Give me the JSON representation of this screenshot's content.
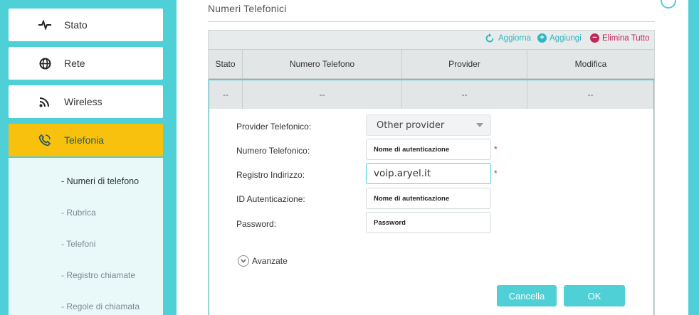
{
  "sidebar": {
    "items": [
      {
        "label": "Stato",
        "icon": "pulse-icon"
      },
      {
        "label": "Rete",
        "icon": "globe-icon"
      },
      {
        "label": "Wireless",
        "icon": "wifi-icon"
      },
      {
        "label": "Telefonia",
        "icon": "phone-icon"
      }
    ],
    "submenu": [
      "- Numeri di telefono",
      "- Rubrica",
      "- Telefoni",
      "- Registro chiamate",
      "- Regole di chiamata"
    ]
  },
  "main": {
    "title": "Numeri Telefonici",
    "toolbar": {
      "refresh": "Aggiorna",
      "add": "Aggiungi",
      "delete_all": "Elimina Tutto"
    },
    "table": {
      "headers": [
        "Stato",
        "Numero Telefono",
        "Provider",
        "Modifica"
      ],
      "row": [
        "--",
        "--",
        "--",
        "--"
      ]
    },
    "form": {
      "provider_label": "Provider Telefonico:",
      "provider_value": "Other provider",
      "number_label": "Numero Telefonico:",
      "number_value": "Nome di autenticazione",
      "registrar_label": "Registro Indirizzo:",
      "registrar_value": "voip.aryel.it",
      "auth_label": "ID Autenticazione:",
      "auth_value": "Nome di autenticazione",
      "password_label": "Password:",
      "password_value": "Password",
      "required_mark": "*",
      "advanced": "Avanzate",
      "cancel": "Cancella",
      "ok": "OK"
    }
  },
  "colors": {
    "accent": "#4fcfd6",
    "active_menu": "#f7c10d",
    "add_green": "#4fcfd6",
    "delete_red": "#c0285a"
  }
}
